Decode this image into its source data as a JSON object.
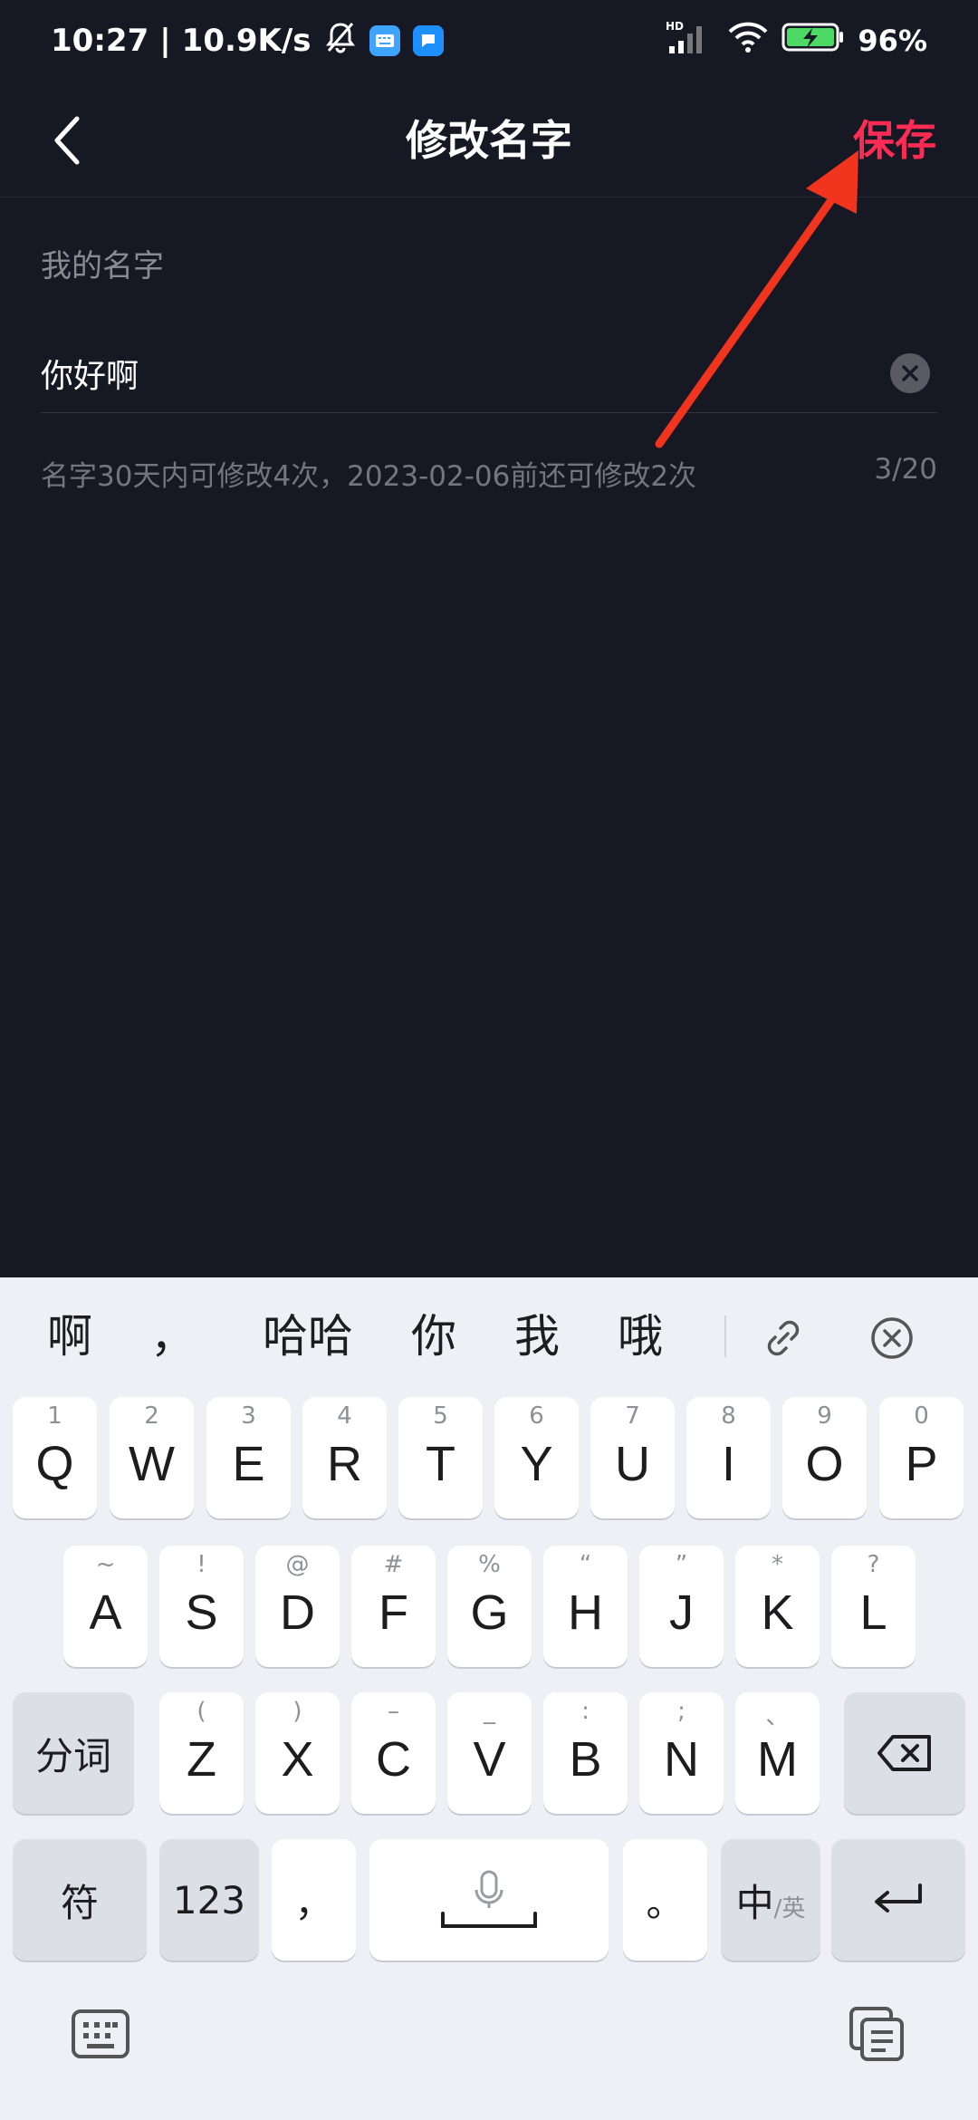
{
  "status_bar": {
    "time": "10:27",
    "net_speed": "10.9K/s",
    "battery": "96%",
    "hd_label": "HD"
  },
  "nav": {
    "title": "修改名字",
    "save_label": "保存"
  },
  "form": {
    "label": "我的名字",
    "name_value": "你好啊",
    "hint": "名字30天内可修改4次，2023-02-06前还可修改2次",
    "counter": "3/20"
  },
  "keyboard": {
    "candidates": [
      "啊",
      "，",
      "哈哈",
      "你",
      "我",
      "哦"
    ],
    "row1": [
      {
        "key": "Q",
        "hint": "1"
      },
      {
        "key": "W",
        "hint": "2"
      },
      {
        "key": "E",
        "hint": "3"
      },
      {
        "key": "R",
        "hint": "4"
      },
      {
        "key": "T",
        "hint": "5"
      },
      {
        "key": "Y",
        "hint": "6"
      },
      {
        "key": "U",
        "hint": "7"
      },
      {
        "key": "I",
        "hint": "8"
      },
      {
        "key": "O",
        "hint": "9"
      },
      {
        "key": "P",
        "hint": "0"
      }
    ],
    "row2": [
      {
        "key": "A",
        "hint": "~"
      },
      {
        "key": "S",
        "hint": "!"
      },
      {
        "key": "D",
        "hint": "@"
      },
      {
        "key": "F",
        "hint": "#"
      },
      {
        "key": "G",
        "hint": "%"
      },
      {
        "key": "H",
        "hint": "“"
      },
      {
        "key": "J",
        "hint": "”"
      },
      {
        "key": "K",
        "hint": "*"
      },
      {
        "key": "L",
        "hint": "?"
      }
    ],
    "row3": [
      {
        "key": "Z",
        "hint": "("
      },
      {
        "key": "X",
        "hint": ")"
      },
      {
        "key": "C",
        "hint": "–"
      },
      {
        "key": "V",
        "hint": "_"
      },
      {
        "key": "B",
        "hint": ":"
      },
      {
        "key": "N",
        "hint": ";"
      },
      {
        "key": "M",
        "hint": "、"
      }
    ],
    "fenci_label": "分词",
    "symbol_label": "符",
    "num_label": "123",
    "comma_label": "，",
    "period_label": "。",
    "lang_main": "中",
    "lang_sub": "/英"
  }
}
